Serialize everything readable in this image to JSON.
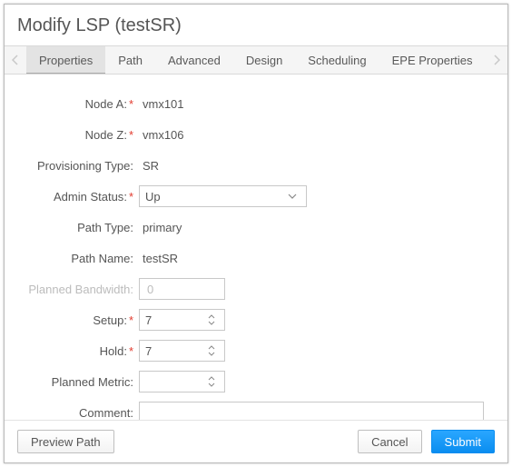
{
  "title": "Modify LSP (testSR)",
  "tabs": {
    "items": [
      "Properties",
      "Path",
      "Advanced",
      "Design",
      "Scheduling",
      "EPE Properties"
    ],
    "active_index": 0
  },
  "form": {
    "node_a": {
      "label": "Node A",
      "required": true,
      "value": "vmx101"
    },
    "node_z": {
      "label": "Node Z",
      "required": true,
      "value": "vmx106"
    },
    "provisioning_type": {
      "label": "Provisioning Type",
      "required": false,
      "value": "SR"
    },
    "admin_status": {
      "label": "Admin Status",
      "required": true,
      "value": "Up"
    },
    "path_type": {
      "label": "Path Type",
      "required": false,
      "value": "primary"
    },
    "path_name": {
      "label": "Path Name",
      "required": false,
      "value": "testSR"
    },
    "planned_bandwidth": {
      "label": "Planned Bandwidth",
      "required": false,
      "value": "0",
      "disabled": true
    },
    "setup": {
      "label": "Setup",
      "required": true,
      "value": "7"
    },
    "hold": {
      "label": "Hold",
      "required": true,
      "value": "7"
    },
    "planned_metric": {
      "label": "Planned Metric",
      "required": false,
      "value": ""
    },
    "comment": {
      "label": "Comment",
      "required": false,
      "value": ""
    }
  },
  "footer": {
    "preview": "Preview Path",
    "cancel": "Cancel",
    "submit": "Submit"
  }
}
